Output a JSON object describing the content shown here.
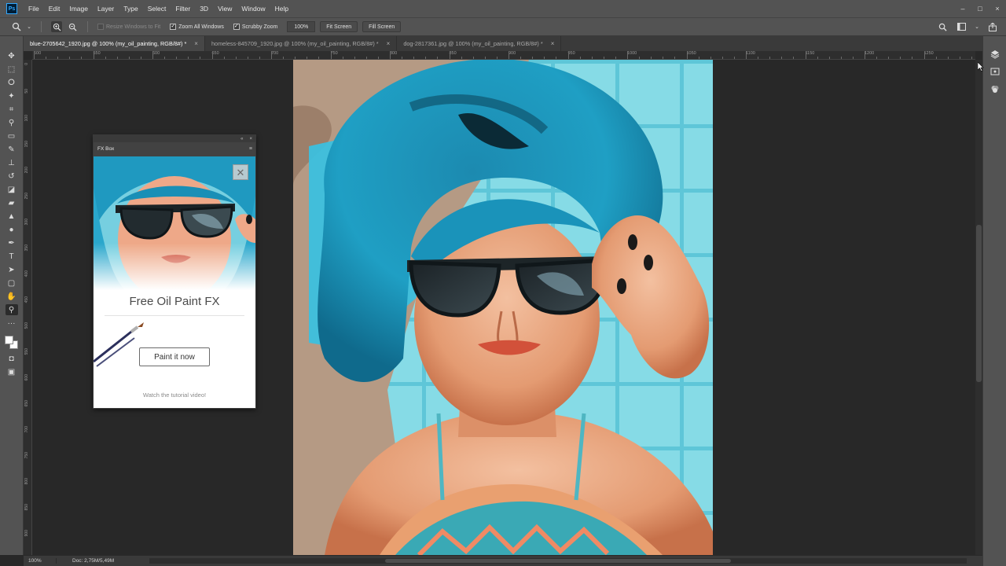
{
  "app": {
    "logo_text": "Ps",
    "menu": [
      "File",
      "Edit",
      "Image",
      "Layer",
      "Type",
      "Select",
      "Filter",
      "3D",
      "View",
      "Window",
      "Help"
    ],
    "window_controls": [
      "–",
      "□",
      "×"
    ]
  },
  "options": {
    "resize_windows_label": "Resize Windows to Fit",
    "zoom_all_windows_label": "Zoom All Windows",
    "scrubby_zoom_label": "Scrubby Zoom",
    "zoom_value": "100%",
    "fit_screen_label": "Fit Screen",
    "fill_screen_label": "Fill Screen"
  },
  "tabs": [
    {
      "label": "blue-2705642_1920.jpg @ 100% (my_oil_painting, RGB/8#) *",
      "active": true
    },
    {
      "label": "homeless-845709_1920.jpg @ 100% (my_oil_painting, RGB/8#) *",
      "active": false
    },
    {
      "label": "dog-2817361.jpg @ 100% (my_oil_painting, RGB/8#) *",
      "active": false
    }
  ],
  "ruler": {
    "h_labels": [
      "500",
      "550",
      "600",
      "650",
      "700",
      "750",
      "800",
      "850",
      "900",
      "950",
      "1000",
      "1050",
      "1100",
      "1150",
      "1200",
      "1250"
    ],
    "v_labels": [
      "0",
      "50",
      "100",
      "150",
      "200",
      "250",
      "300",
      "350",
      "400",
      "450",
      "500",
      "550",
      "600",
      "650",
      "700",
      "750",
      "800",
      "850",
      "900",
      "950"
    ]
  },
  "tools": [
    {
      "name": "move-tool",
      "glyph": "✥"
    },
    {
      "name": "marquee-tool",
      "glyph": "⬚"
    },
    {
      "name": "lasso-tool",
      "glyph": "ⵔ"
    },
    {
      "name": "magic-wand-tool",
      "glyph": "✦"
    },
    {
      "name": "crop-tool",
      "glyph": "⌗"
    },
    {
      "name": "eyedropper-tool",
      "glyph": "⚲"
    },
    {
      "name": "frame-tool",
      "glyph": "▭"
    },
    {
      "name": "brush-tool",
      "glyph": "✎"
    },
    {
      "name": "stamp-tool",
      "glyph": "⊥"
    },
    {
      "name": "history-brush-tool",
      "glyph": "↺"
    },
    {
      "name": "eraser-tool",
      "glyph": "◪"
    },
    {
      "name": "gradient-tool",
      "glyph": "▰"
    },
    {
      "name": "blur-tool",
      "glyph": "▲"
    },
    {
      "name": "dodge-tool",
      "glyph": "●"
    },
    {
      "name": "pen-tool",
      "glyph": "✒"
    },
    {
      "name": "type-tool",
      "glyph": "T"
    },
    {
      "name": "path-selection-tool",
      "glyph": "➤"
    },
    {
      "name": "shape-tool",
      "glyph": "▢"
    },
    {
      "name": "hand-tool",
      "glyph": "✋"
    },
    {
      "name": "zoom-tool",
      "glyph": "⚲",
      "active": true
    },
    {
      "name": "more-tools",
      "glyph": "···"
    }
  ],
  "fx_box": {
    "title": "FX Box",
    "close_glyph": "✕",
    "heading": "Free Oil Paint FX",
    "button_label": "Paint it now",
    "tutorial_link": "Watch the tutorial video!"
  },
  "status": {
    "zoom": "100%",
    "doc_size": "Doc: 2,75M/5,49M"
  }
}
